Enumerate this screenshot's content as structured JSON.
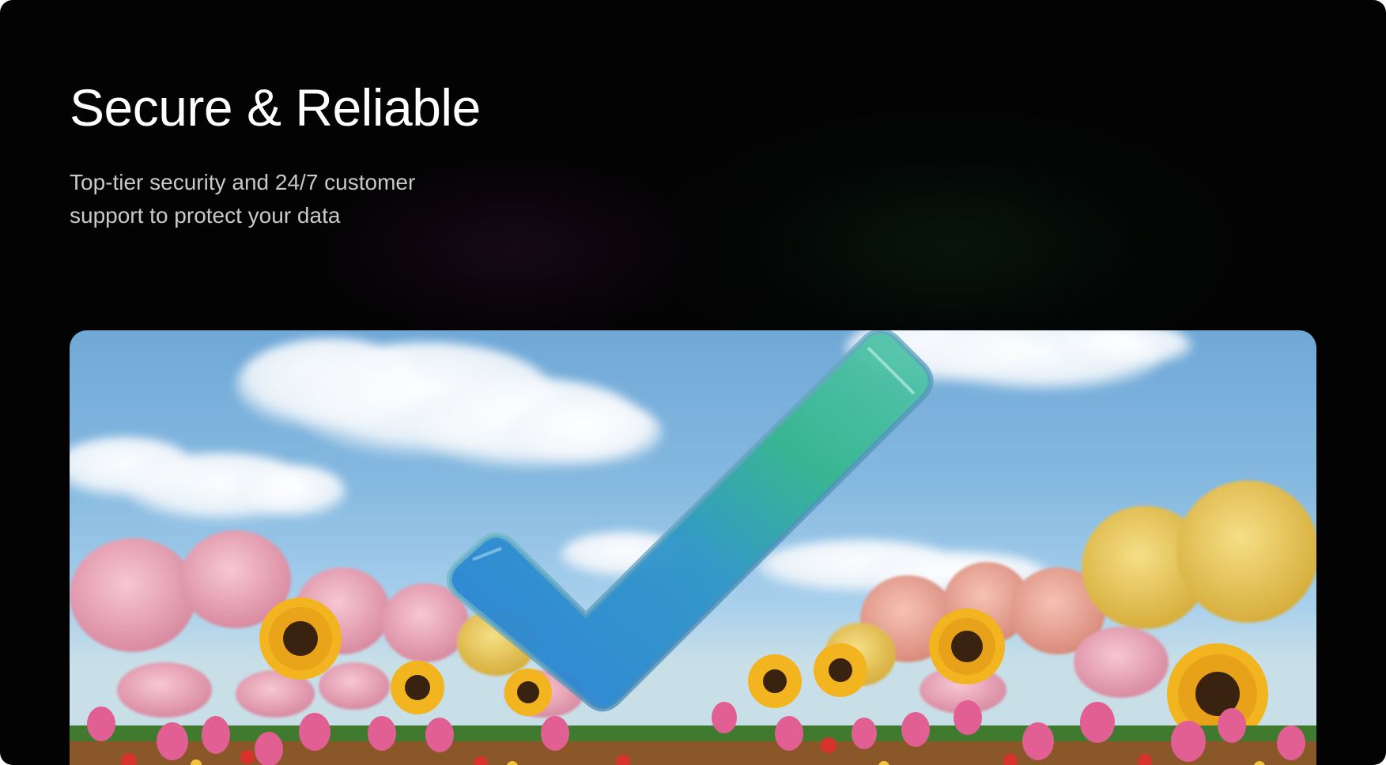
{
  "header": {
    "title": "Secure & Reliable",
    "subtitle_line1": "Top-tier security and 24/7 customer",
    "subtitle_line2": "support to protect your data"
  },
  "hero": {
    "scene": "checkmark-in-flower-field",
    "colors": {
      "background": "#030303",
      "sky": "#86b9e0",
      "check_start": "#2f86d6",
      "check_end": "#3fc59a"
    }
  }
}
